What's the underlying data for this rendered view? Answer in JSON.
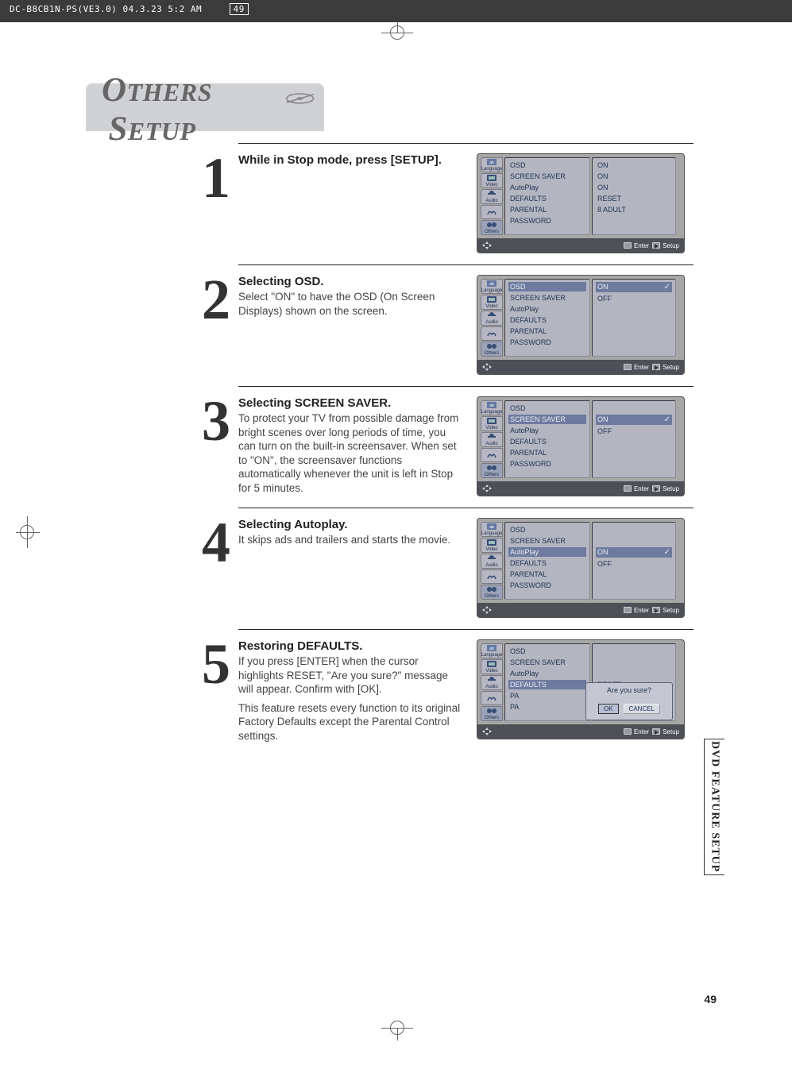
{
  "header": {
    "doc_id": "DC-B8CB1N-PS(VE3.0)  04.3.23 5:2 AM",
    "page_mark": "49"
  },
  "page": {
    "title_part1": "O",
    "title_part1b": "THERS",
    "title_part2": "S",
    "title_part2b": "ETUP",
    "number": "49",
    "side_tab": "DVD FEATURE SETUP"
  },
  "menu_items": [
    "OSD",
    "SCREEN SAVER",
    "AutoPlay",
    "DEFAULTS",
    "PARENTAL",
    "PASSWORD"
  ],
  "tabs": [
    "Language",
    "Video",
    "Audio",
    "",
    "Others"
  ],
  "footer": {
    "enter": "Enter",
    "setup": "Setup"
  },
  "steps": [
    {
      "num": "1",
      "title": "While in Stop mode, press [SETUP].",
      "body": "",
      "osd": {
        "selected_item": null,
        "vals": [
          "ON",
          "ON",
          "ON",
          "RESET",
          "8 ADULT"
        ],
        "val_selected": null
      }
    },
    {
      "num": "2",
      "title": "Selecting OSD.",
      "body": "Select \"ON\" to have the OSD (On Screen Displays) shown on the screen.",
      "osd": {
        "selected_item": 0,
        "vals": [
          "ON",
          "OFF"
        ],
        "val_selected": 0
      }
    },
    {
      "num": "3",
      "title": "Selecting SCREEN SAVER.",
      "body": "To protect your TV from possible damage from bright scenes over long periods of time, you can turn on the built-in screensaver. When set to \"ON\", the screensaver functions automatically whenever the unit is left in Stop for 5 minutes.",
      "osd": {
        "selected_item": 1,
        "vals": [
          "ON",
          "OFF"
        ],
        "val_selected": 0
      }
    },
    {
      "num": "4",
      "title": "Selecting Autoplay.",
      "body": "It skips ads and trailers and starts the movie.",
      "osd": {
        "selected_item": 2,
        "vals": [
          "ON",
          "OFF"
        ],
        "val_selected": 0
      }
    },
    {
      "num": "5",
      "title": "Restoring DEFAULTS.",
      "body": "If you press [ENTER] when the cursor highlights RESET, \"Are you sure?\" message will appear. Confirm with [OK].",
      "body2": "This feature resets every function to its original Factory Defaults except the Parental Control settings.",
      "osd": {
        "selected_item": 3,
        "vals": [
          "RESET"
        ],
        "modal": {
          "text": "Are you sure?",
          "ok": "OK",
          "cancel": "CANCEL"
        }
      }
    }
  ]
}
